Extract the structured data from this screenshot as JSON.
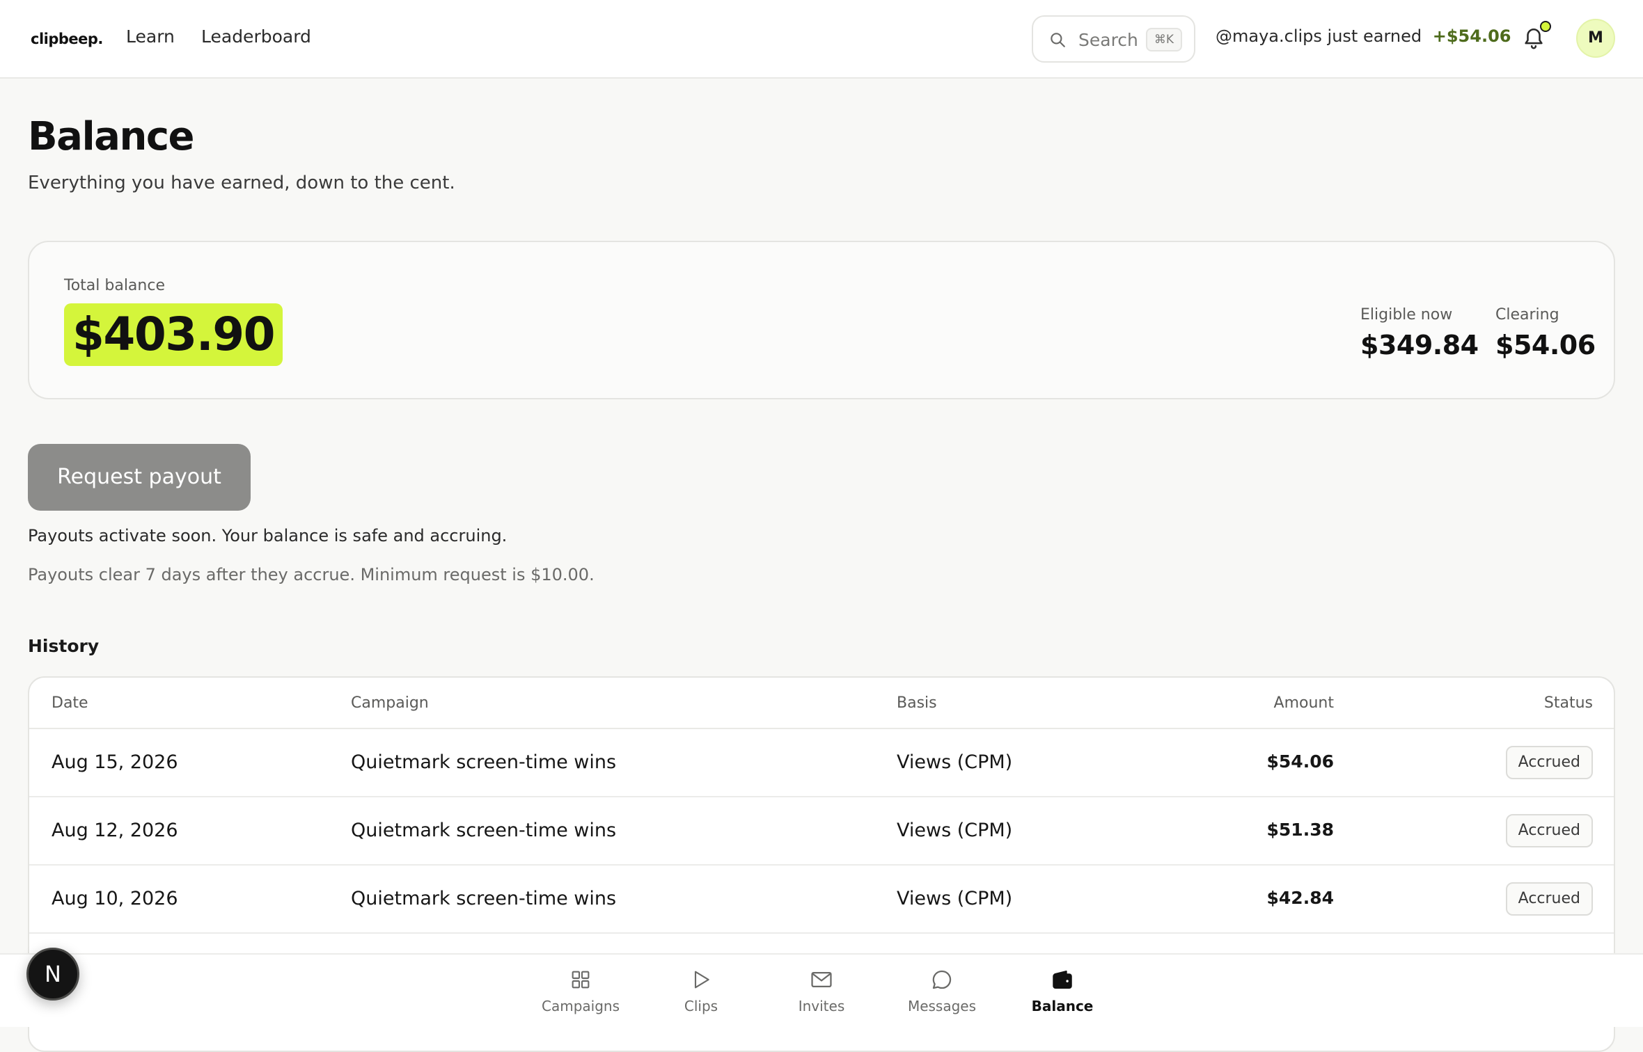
{
  "header": {
    "logo": "clipbeep.",
    "nav": [
      "Learn",
      "Leaderboard"
    ],
    "search": {
      "label": "Search",
      "shortcut": "⌘K"
    },
    "ticker": {
      "user": "@maya.clips",
      "text": "just earned",
      "amount": "+$54.06"
    },
    "avatar_initial": "M"
  },
  "page": {
    "title": "Balance",
    "subtitle": "Everything you have earned, down to the cent."
  },
  "balance": {
    "total_label": "Total balance",
    "total": "$403.90",
    "eligible_label": "Eligible now",
    "eligible": "$349.84",
    "clearing_label": "Clearing",
    "clearing": "$54.06"
  },
  "payout": {
    "button_label": "Request payout",
    "note_primary": "Payouts activate soon. Your balance is safe and accruing.",
    "note_secondary": "Payouts clear 7 days after they accrue. Minimum request is $10.00."
  },
  "history": {
    "title": "History",
    "columns": [
      "Date",
      "Campaign",
      "Basis",
      "Amount",
      "Status"
    ],
    "rows": [
      {
        "date": "Aug 15, 2026",
        "campaign": "Quietmark screen-time wins",
        "basis": "Views (CPM)",
        "amount": "$54.06",
        "status": "Accrued"
      },
      {
        "date": "Aug 12, 2026",
        "campaign": "Quietmark screen-time wins",
        "basis": "Views (CPM)",
        "amount": "$51.38",
        "status": "Accrued"
      },
      {
        "date": "Aug 10, 2026",
        "campaign": "Quietmark screen-time wins",
        "basis": "Views (CPM)",
        "amount": "$42.84",
        "status": "Accrued"
      }
    ]
  },
  "bottom_nav": [
    {
      "label": "Campaigns",
      "icon": "grid-icon"
    },
    {
      "label": "Clips",
      "icon": "play-icon"
    },
    {
      "label": "Invites",
      "icon": "mail-icon"
    },
    {
      "label": "Messages",
      "icon": "chat-bubble-icon"
    },
    {
      "label": "Balance",
      "icon": "wallet-icon",
      "active": true
    }
  ],
  "dev_badge": "N",
  "colors": {
    "accent": "#d4f53b",
    "ticker_amount": "#4e6b1c",
    "disabled_button": "#8c8c8a"
  }
}
